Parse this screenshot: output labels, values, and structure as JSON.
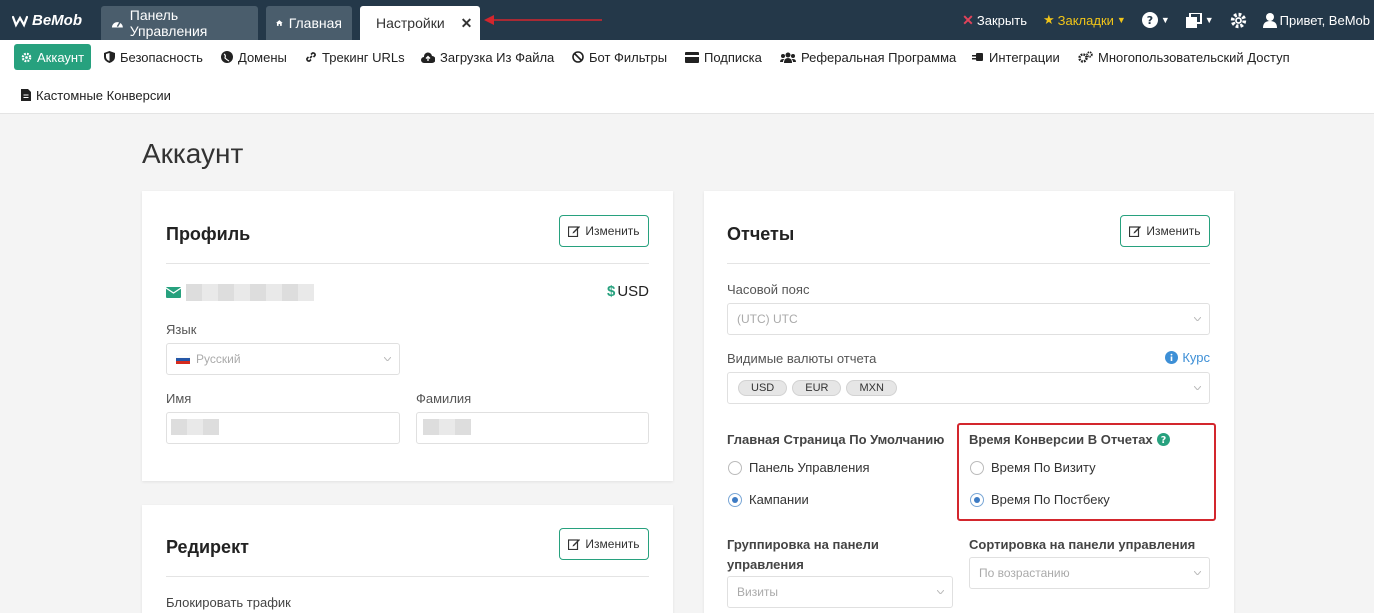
{
  "topbar": {
    "logo": "BeMob",
    "tabs": [
      {
        "label": "Панель Управления"
      },
      {
        "label": "Главная"
      },
      {
        "label": "Настройки"
      }
    ],
    "close_label": "Закрыть",
    "bookmarks_label": "Закладки",
    "greeting": "Привет, BeMob"
  },
  "subnav": {
    "items": [
      {
        "label": "Аккаунт"
      },
      {
        "label": "Безопасность"
      },
      {
        "label": "Домены"
      },
      {
        "label": "Трекинг URLs"
      },
      {
        "label": "Загрузка Из Файла"
      },
      {
        "label": "Бот Фильтры"
      },
      {
        "label": "Подписка"
      },
      {
        "label": "Реферальная Программа"
      },
      {
        "label": "Интеграции"
      },
      {
        "label": "Многопользовательский Доступ"
      },
      {
        "label": "Кастомные Конверсии"
      }
    ]
  },
  "page": {
    "title": "Аккаунт"
  },
  "profile": {
    "title": "Профиль",
    "edit_label": "Изменить",
    "currency_symbol": "$",
    "currency": "USD",
    "language_label": "Язык",
    "language_value": "Русский",
    "first_name_label": "Имя",
    "last_name_label": "Фамилия"
  },
  "redirect": {
    "title": "Редирект",
    "edit_label": "Изменить",
    "block_traffic_label": "Блокировать трафик"
  },
  "reports": {
    "title": "Отчеты",
    "edit_label": "Изменить",
    "timezone_label": "Часовой пояс",
    "timezone_value": "(UTC) UTC",
    "currencies_label": "Видимые валюты отчета",
    "rate_label": "Курс",
    "currencies": [
      "USD",
      "EUR",
      "MXN"
    ],
    "default_page_label": "Главная Страница По Умолчанию",
    "default_page_options": [
      "Панель Управления",
      "Кампании"
    ],
    "conversion_time_label": "Время Конверсии В Отчетах",
    "conversion_time_options": [
      "Время По Визиту",
      "Время По Постбеку"
    ],
    "grouping_label": "Группировка на панели управления",
    "grouping_value": "Визиты",
    "sorting_label": "Сортировка на панели управления",
    "sorting_value": "По возрастанию"
  },
  "colors": {
    "topbar": "#243849",
    "accent": "#27a17e",
    "highlight": "#d3262d"
  }
}
